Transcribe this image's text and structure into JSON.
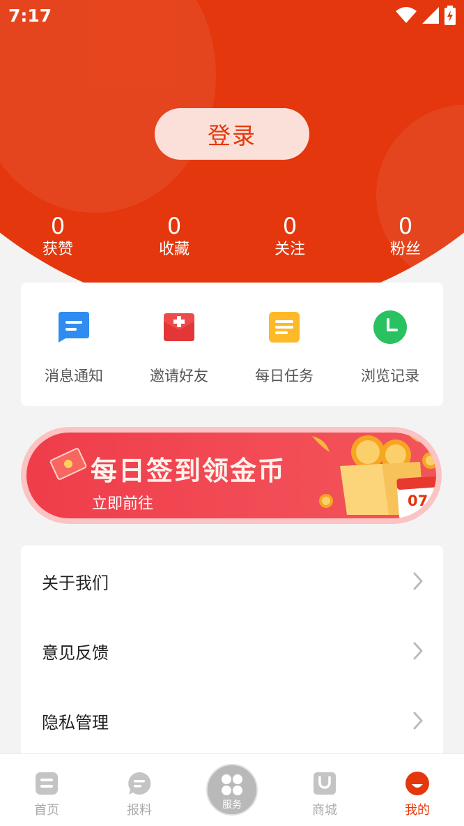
{
  "status_bar": {
    "time": "7:17"
  },
  "login": {
    "label": "登录"
  },
  "stats": [
    {
      "value": "0",
      "label": "获赞"
    },
    {
      "value": "0",
      "label": "收藏"
    },
    {
      "value": "0",
      "label": "关注"
    },
    {
      "value": "0",
      "label": "粉丝"
    }
  ],
  "quick_actions": [
    {
      "label": "消息通知",
      "icon": "message-icon"
    },
    {
      "label": "邀请好友",
      "icon": "invite-envelope-icon"
    },
    {
      "label": "每日任务",
      "icon": "task-note-icon"
    },
    {
      "label": "浏览记录",
      "icon": "clock-icon"
    }
  ],
  "banner": {
    "title": "每日签到领金币",
    "subtitle": "立即前往",
    "calendar_day": "07"
  },
  "menu": [
    {
      "label": "关于我们"
    },
    {
      "label": "意见反馈"
    },
    {
      "label": "隐私管理"
    }
  ],
  "tab_bar": {
    "tabs": [
      {
        "label": "首页"
      },
      {
        "label": "报料"
      },
      {
        "label": "服务"
      },
      {
        "label": "商城"
      },
      {
        "label": "我的"
      }
    ],
    "active": "我的"
  },
  "colors": {
    "brand": "#e4370d",
    "inactive": "#aaaaaa"
  }
}
